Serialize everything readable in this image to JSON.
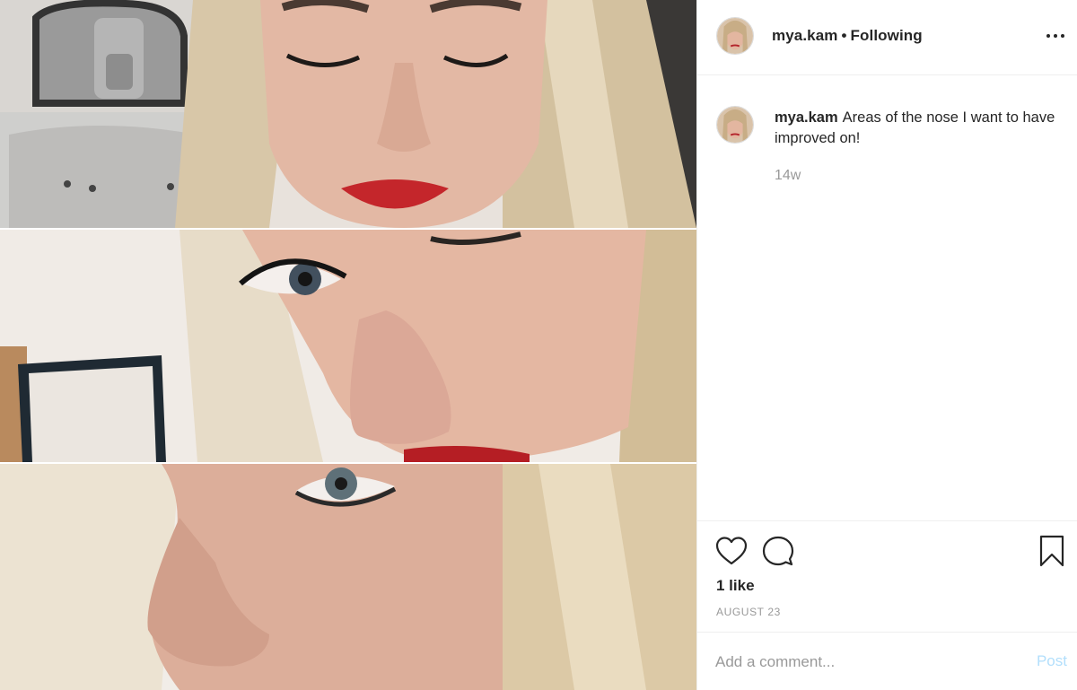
{
  "post": {
    "username": "mya.kam",
    "separator": "•",
    "follow_status": "Following",
    "caption_text": "Areas of the nose I want to have improved on!",
    "time_ago": "14w",
    "likes": "1 like",
    "date": "AUGUST 23"
  },
  "comment_box": {
    "placeholder": "Add a comment...",
    "post_label": "Post"
  },
  "icons": {
    "like": "heart-icon",
    "comment": "speech-bubble-icon",
    "save": "bookmark-icon",
    "more": "more-options-icon"
  },
  "colors": {
    "text": "#262626",
    "muted": "#999999",
    "border": "#efefef",
    "post_button_disabled": "#b2dffc"
  }
}
